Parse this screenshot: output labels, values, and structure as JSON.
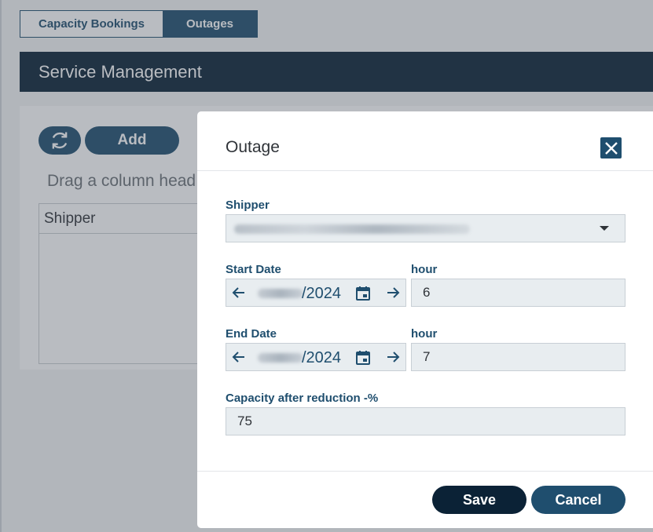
{
  "tabs": [
    {
      "label": "Capacity Bookings",
      "active": false
    },
    {
      "label": "Outages",
      "active": true
    }
  ],
  "page_title": "Service Management",
  "toolbar": {
    "refresh_icon": "refresh-icon",
    "add_label": "Add"
  },
  "grid": {
    "drag_hint": "Drag a column head",
    "column_header": "Shipper"
  },
  "modal": {
    "title": "Outage",
    "close_icon": "close-icon",
    "shipper": {
      "label": "Shipper",
      "value_blurred": true
    },
    "start_date": {
      "label": "Start Date",
      "value_suffix": "/2024",
      "hour_label": "hour",
      "hour_value": "6"
    },
    "end_date": {
      "label": "End Date",
      "value_suffix": "/2024",
      "hour_label": "hour",
      "hour_value": "7"
    },
    "capacity": {
      "label": "Capacity after reduction -%",
      "value": "75"
    },
    "save_label": "Save",
    "cancel_label": "Cancel"
  },
  "colors": {
    "primary": "#1f4e6e",
    "dark": "#0b2236",
    "field_bg": "#e8edf0"
  }
}
